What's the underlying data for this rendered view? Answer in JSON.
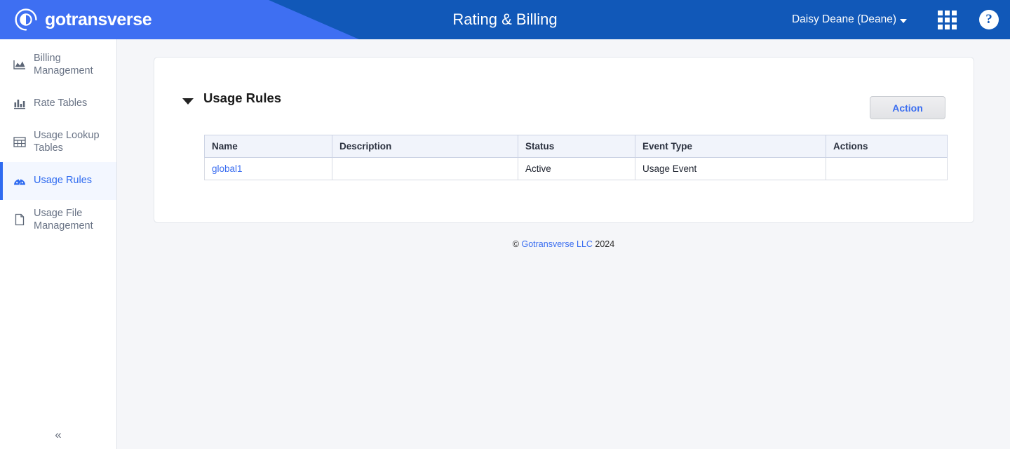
{
  "header": {
    "logo_text": "gotransverse",
    "logo_icon": "gotransverse-circle-logo",
    "title": "Rating & Billing",
    "user_name": "Daisy Deane (Deane)",
    "apps_icon": "grid-apps-icon",
    "help_icon": "?",
    "colors": {
      "primary": "#1158b8",
      "accent": "#3e6ff2"
    }
  },
  "sidebar": {
    "items": [
      {
        "label": "Billing Management",
        "icon": "area-chart-icon",
        "active": false
      },
      {
        "label": "Rate Tables",
        "icon": "bar-chart-icon",
        "active": false
      },
      {
        "label": "Usage Lookup Tables",
        "icon": "table-grid-icon",
        "active": false
      },
      {
        "label": "Usage Rules",
        "icon": "gauge-icon",
        "active": true
      },
      {
        "label": "Usage File Management",
        "icon": "file-icon",
        "active": false
      }
    ],
    "collapse_icon": "«"
  },
  "main": {
    "section": {
      "title": "Usage Rules",
      "toggle_icon": "triangle-down-icon",
      "expanded": true
    },
    "action_button_label": "Action",
    "table": {
      "columns": [
        "Name",
        "Description",
        "Status",
        "Event Type",
        "Actions"
      ],
      "rows": [
        {
          "name": "global1",
          "description": "",
          "status": "Active",
          "event_type": "Usage Event",
          "actions": ""
        }
      ]
    }
  },
  "footer": {
    "copyright_symbol": "©",
    "company": "Gotransverse LLC",
    "year": "2024"
  }
}
